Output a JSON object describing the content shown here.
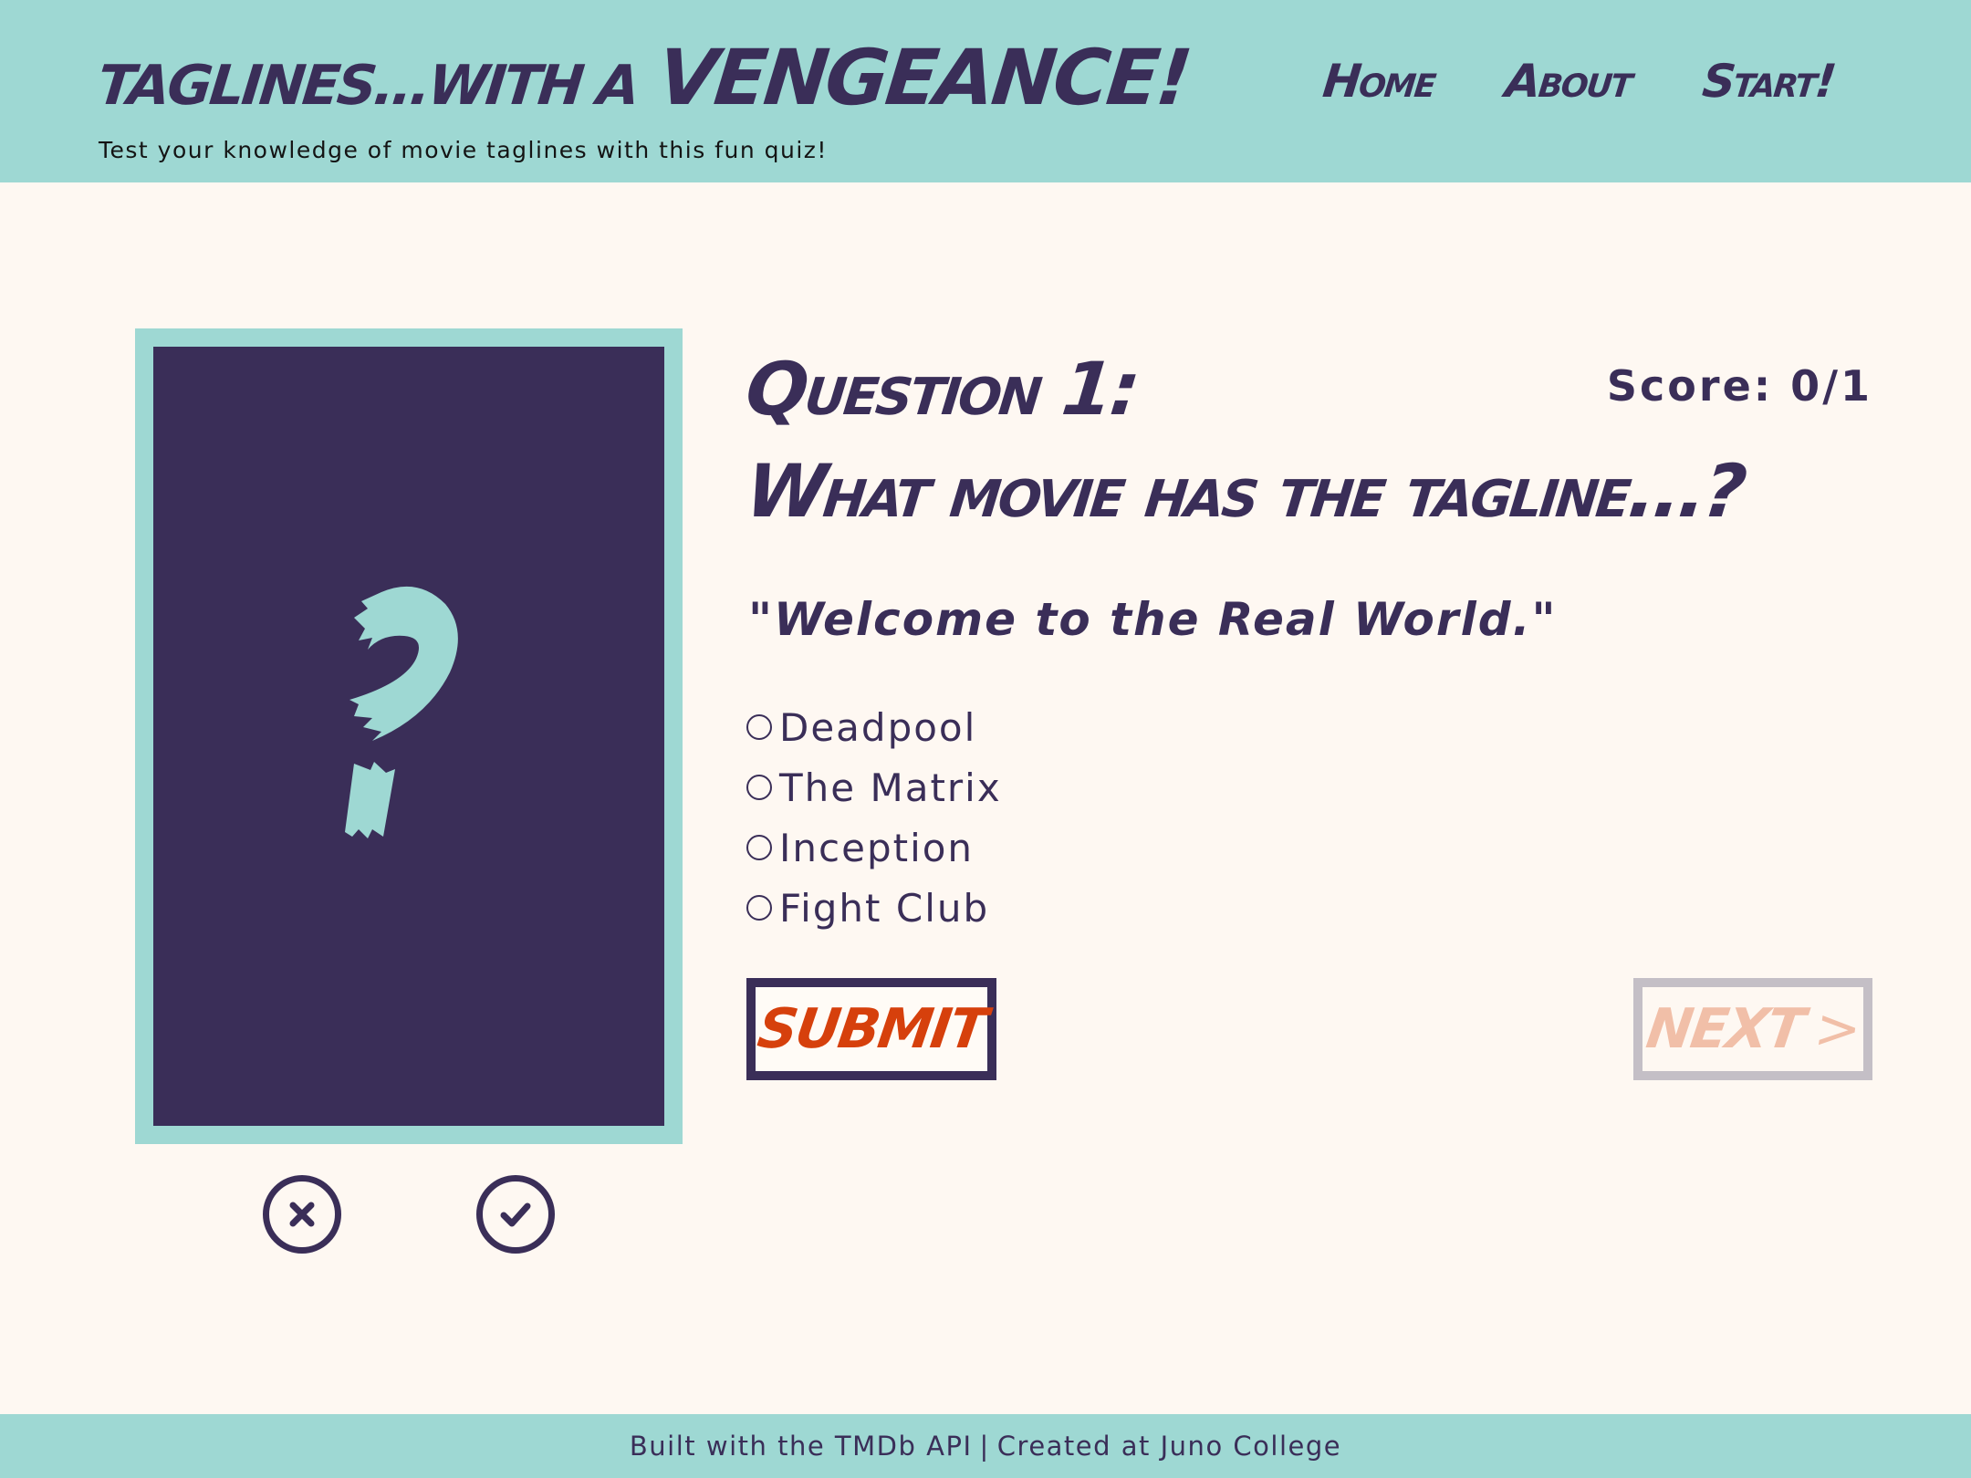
{
  "header": {
    "title_part1": "taglines...with a",
    "title_part2": "VENGEANCE!",
    "subtitle": "Test your knowledge of movie taglines with this fun quiz!",
    "nav": [
      {
        "label": "Home"
      },
      {
        "label": "About"
      },
      {
        "label": "Start!"
      }
    ]
  },
  "quiz": {
    "question_number": "Question 1:",
    "question_text": "What movie has the tagline...?",
    "score": "Score: 0/1",
    "tagline_quote": "\"Welcome to the Real World.\"",
    "options": [
      {
        "label": "Deadpool"
      },
      {
        "label": "The Matrix"
      },
      {
        "label": "Inception"
      },
      {
        "label": "Fight Club"
      }
    ],
    "submit_label": "SUBMIT",
    "next_label": "NEXT",
    "next_chevron": ">"
  },
  "poster": {
    "icon": "question-mark-icon"
  },
  "feedback": {
    "wrong_icon": "x-circle-icon",
    "right_icon": "check-circle-icon"
  },
  "footer": {
    "part1": "Built with the TMDb API",
    "separator": "|",
    "part2": "Created at Juno College"
  },
  "colors": {
    "teal": "#9ed8d3",
    "navy": "#3a2e58",
    "background": "#fef8f2",
    "submit_red": "#d6400c",
    "next_disabled": "#f1bfa8"
  }
}
